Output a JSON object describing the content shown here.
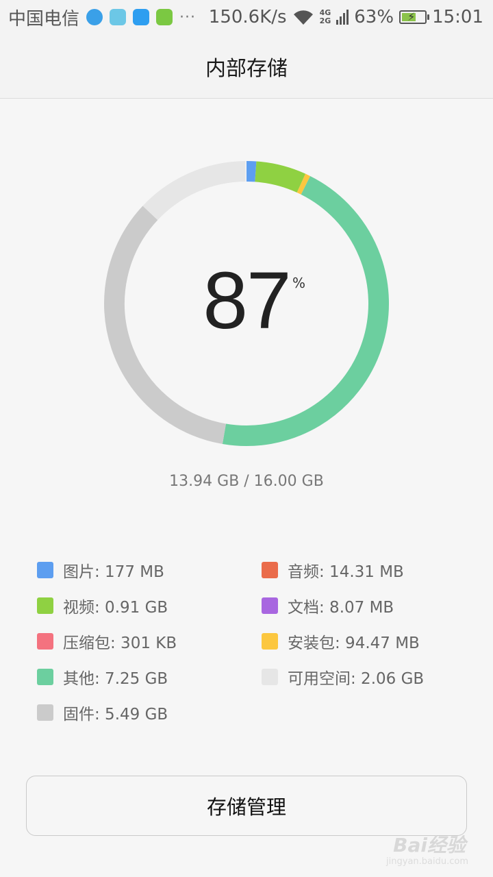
{
  "status_bar": {
    "carrier": "中国电信",
    "more": "···",
    "net_speed": "150.6K/s",
    "net_type_top": "4G",
    "net_type_bottom": "2G",
    "battery": "63%",
    "battery_level": 0.63,
    "time": "15:01",
    "notification_icons": [
      {
        "name": "browser-icon",
        "color": "#3aa0e8"
      },
      {
        "name": "android-icon",
        "color": "#6cc7e6"
      },
      {
        "name": "message-icon",
        "color": "#2e9ef0"
      },
      {
        "name": "shield-icon",
        "color": "#7bc842"
      }
    ]
  },
  "header": {
    "title": "内部存储"
  },
  "chart_data": {
    "type": "pie",
    "title": "",
    "percent_value": "87",
    "percent_sign": "%",
    "total_gb": 16.0,
    "used_gb": 13.94,
    "segments": [
      {
        "label": "图片",
        "value_gb": 0.177,
        "color": "#5d9ef0"
      },
      {
        "label": "视频",
        "value_gb": 0.91,
        "color": "#8fd142"
      },
      {
        "label": "安装包",
        "value_gb": 0.09447,
        "color": "#fcc73f"
      },
      {
        "label": "其他",
        "value_gb": 7.25,
        "color": "#6ccf9f"
      },
      {
        "label": "固件",
        "value_gb": 5.49,
        "color": "#cbcbcb"
      },
      {
        "label": "可用空间",
        "value_gb": 2.06,
        "color": "#e6e6e6"
      }
    ]
  },
  "usage": "13.94 GB / 16.00 GB",
  "legend": [
    {
      "text": "图片: 177 MB",
      "color": "#5d9ef0"
    },
    {
      "text": "音频: 14.31 MB",
      "color": "#ea6c4b"
    },
    {
      "text": "视频: 0.91 GB",
      "color": "#8fd142"
    },
    {
      "text": "文档: 8.07 MB",
      "color": "#a866e0"
    },
    {
      "text": "压缩包: 301 KB",
      "color": "#f4727f"
    },
    {
      "text": "安装包: 94.47 MB",
      "color": "#fcc73f"
    },
    {
      "text": "其他: 7.25 GB",
      "color": "#6ccf9f"
    },
    {
      "text": "可用空间: 2.06 GB",
      "color": "#e6e6e6"
    },
    {
      "text": "固件: 5.49 GB",
      "color": "#cbcbcb"
    }
  ],
  "button": {
    "label": "存储管理"
  },
  "watermark": {
    "text": "Bai经验",
    "sub": "jingyan.baidu.com"
  }
}
